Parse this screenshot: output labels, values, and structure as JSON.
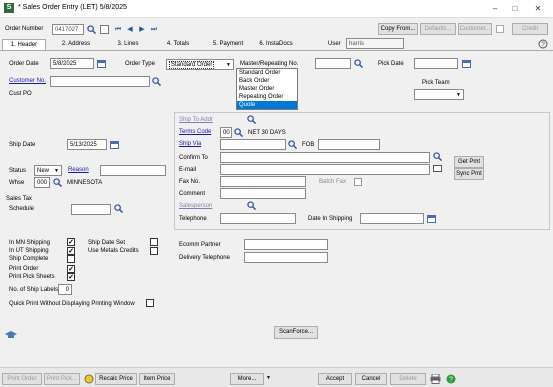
{
  "window": {
    "title": "* Sales Order Entry (LET) 5/8/2025"
  },
  "toolbar": {
    "order_number_label": "Order Number",
    "order_number": "0417027",
    "copy_from": "Copy From...",
    "defaults": "Defaults...",
    "customer": "Customer...",
    "credit": "Credit"
  },
  "tabs": [
    {
      "label": "1. Header"
    },
    {
      "label": "2. Address"
    },
    {
      "label": "3. Lines"
    },
    {
      "label": "4. Totals"
    },
    {
      "label": "5. Payment"
    },
    {
      "label": "6. InstaDocs"
    }
  ],
  "user": {
    "label": "User",
    "value": "harris"
  },
  "header": {
    "order_date_label": "Order Date",
    "order_date": "5/8/2025",
    "order_type_label": "Order Type",
    "order_type": "Standard Order",
    "order_type_options": [
      "Standard Order",
      "Back Order",
      "Master Order",
      "Repeating Order",
      "Quote"
    ],
    "master_repeating_label": "Master/Repeating No.",
    "pick_date_label": "Pick Date",
    "customer_no_label": "Customer No.",
    "pick_team_label": "Pick Team",
    "cust_po_label": "Cust PO",
    "ship_date_label": "Ship Date",
    "ship_date": "5/13/2025",
    "ship_to_addr_label": "Ship To Addr",
    "terms_code_label": "Terms Code",
    "terms_code": "00",
    "terms_desc": "NET 30 DAYS",
    "ship_via_label": "Ship Via",
    "fob_label": "FOB",
    "confirm_to_label": "Confirm To",
    "email_label": "E-mail",
    "fax_label": "Fax No.",
    "batch_fax_label": "Batch Fax",
    "comment_label": "Comment",
    "salesperson_label": "Salesperson",
    "telephone_label": "Telephone",
    "date_in_shipping_label": "Date In Shipping",
    "get_pmt": "Get Pmt",
    "sync_pmt": "Sync Pmt",
    "status_label": "Status",
    "status": "New",
    "reason_label": "Reason",
    "whse_label": "Whse",
    "whse": "000",
    "whse_desc": "MINNESOTA",
    "sales_tax_label": "Sales Tax",
    "schedule_label": "Schedule"
  },
  "options": {
    "in_mn_shipping": "In MN Shipping",
    "in_ut_shipping": "In UT Shipping",
    "ship_complete": "Ship Complete",
    "print_order": "Print Order",
    "print_pick_sheets": "Print Pick Sheets",
    "ship_labels_label": "No. of Ship Labels",
    "ship_labels": "0",
    "ship_date_set": "Ship Date Set",
    "use_metals_credits": "Use Metals Credits",
    "quick_print": "Quick Print Without Displaying Printing Window"
  },
  "ecomm": {
    "ecomm_partner_label": "Ecomm Partner",
    "delivery_telephone_label": "Delivery Telephone"
  },
  "scanforce": "ScanForce...",
  "bottom": {
    "print_order": "Print Order",
    "print_pick": "Print Pick...",
    "recalc_price": "Recalc Price",
    "item_price": "Item Price",
    "more": "More...",
    "accept": "Accept",
    "cancel": "Cancel",
    "delete": "Delete"
  }
}
